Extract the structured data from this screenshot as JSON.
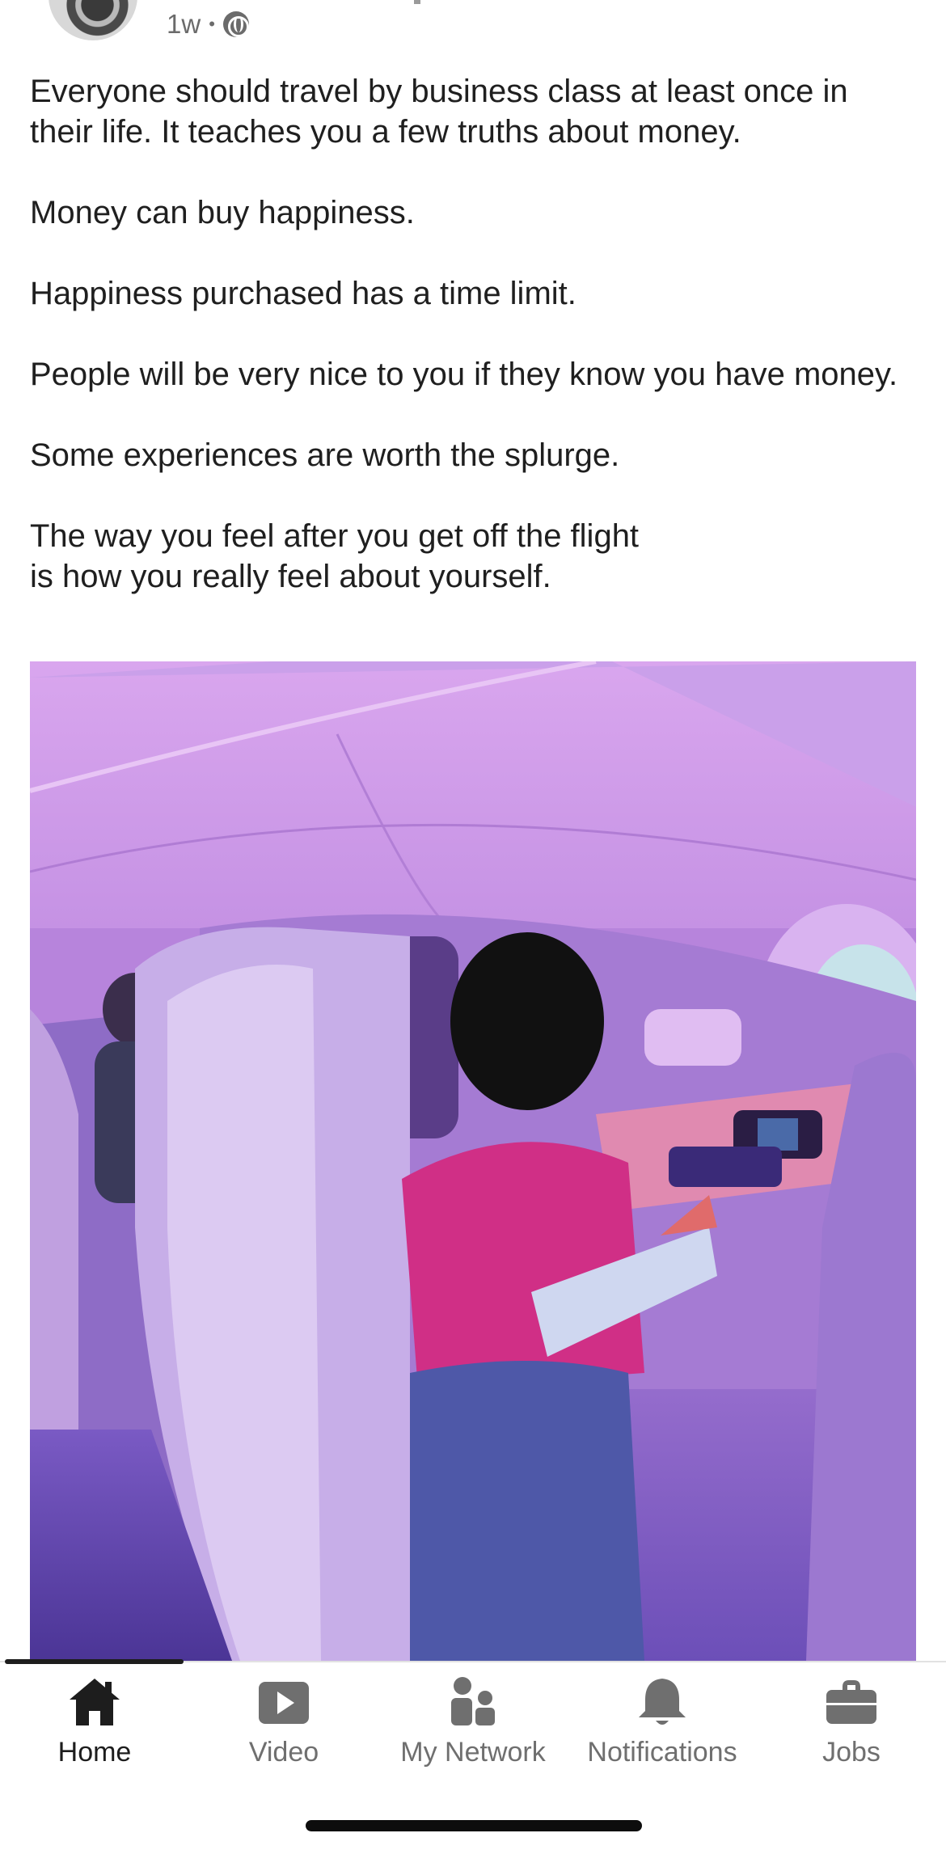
{
  "post": {
    "time_ago": "1w",
    "separator": "•",
    "visibility_icon": "globe-icon",
    "paragraphs": [
      "Everyone should travel by business class at least once in their life. It teaches you a few truths about money.",
      "Money can buy happiness.",
      "Happiness purchased has a time limit.",
      "People will be very nice to you if they know you have money.",
      "Some experiences are worth the splurge.",
      "The way you feel after you get off the flight is how you really feel about yourself."
    ]
  },
  "bottom_nav": {
    "items": [
      {
        "label": "Home",
        "icon": "home-icon",
        "active": true
      },
      {
        "label": "Video",
        "icon": "video-icon",
        "active": false
      },
      {
        "label": "My Network",
        "icon": "network-icon",
        "active": false
      },
      {
        "label": "Notifications",
        "icon": "bell-icon",
        "active": false
      },
      {
        "label": "Jobs",
        "icon": "briefcase-icon",
        "active": false
      }
    ]
  },
  "colors": {
    "active_nav": "#1d1d1d",
    "inactive_nav": "#6f6f6f",
    "photo_tint": "#b985dc"
  }
}
